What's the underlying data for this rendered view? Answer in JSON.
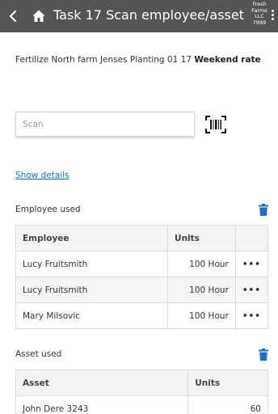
{
  "header": {
    "title": "Task 17 Scan employee/asset",
    "company_lines": [
      "Fresh",
      "Farms",
      "LLC",
      "7999"
    ]
  },
  "task": {
    "description": "Fertilize North farm Jenses Planting 01 17",
    "rate": "Weekend rate"
  },
  "scan": {
    "placeholder": "Scan",
    "value": ""
  },
  "show_details_label": "Show details",
  "employees": {
    "section_label": "Employee used",
    "columns": [
      "Employee",
      "Units"
    ],
    "rows": [
      {
        "name": "Lucy Fruitsmith",
        "units": "100 Hour"
      },
      {
        "name": "Lucy Fruitsmith",
        "units": "100 Hour"
      },
      {
        "name": "Mary Milsovic",
        "units": "100 Hour"
      }
    ]
  },
  "assets": {
    "section_label": "Asset used",
    "columns": [
      "Asset",
      "Units"
    ],
    "rows": [
      {
        "name": "John Dere 3243",
        "units": "60"
      }
    ]
  },
  "menu_glyph": "•••",
  "colors": {
    "appbar": "#555555",
    "link": "#1a6fc4",
    "trash": "#1f6fc5"
  }
}
